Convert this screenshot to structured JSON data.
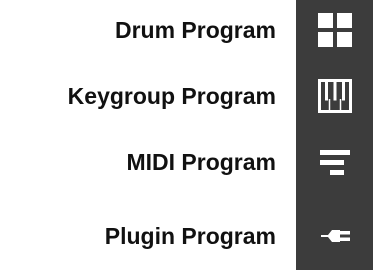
{
  "menu": {
    "items": [
      {
        "label": "Drum Program",
        "icon": "grid-pads-icon"
      },
      {
        "label": "Keygroup Program",
        "icon": "piano-keys-icon"
      },
      {
        "label": "MIDI Program",
        "icon": "midi-lines-icon"
      },
      {
        "label": "Plugin Program",
        "icon": "plug-icon"
      }
    ]
  },
  "colors": {
    "rail": "#3c3c3c",
    "icon": "#ffffff",
    "text": "#111111"
  }
}
